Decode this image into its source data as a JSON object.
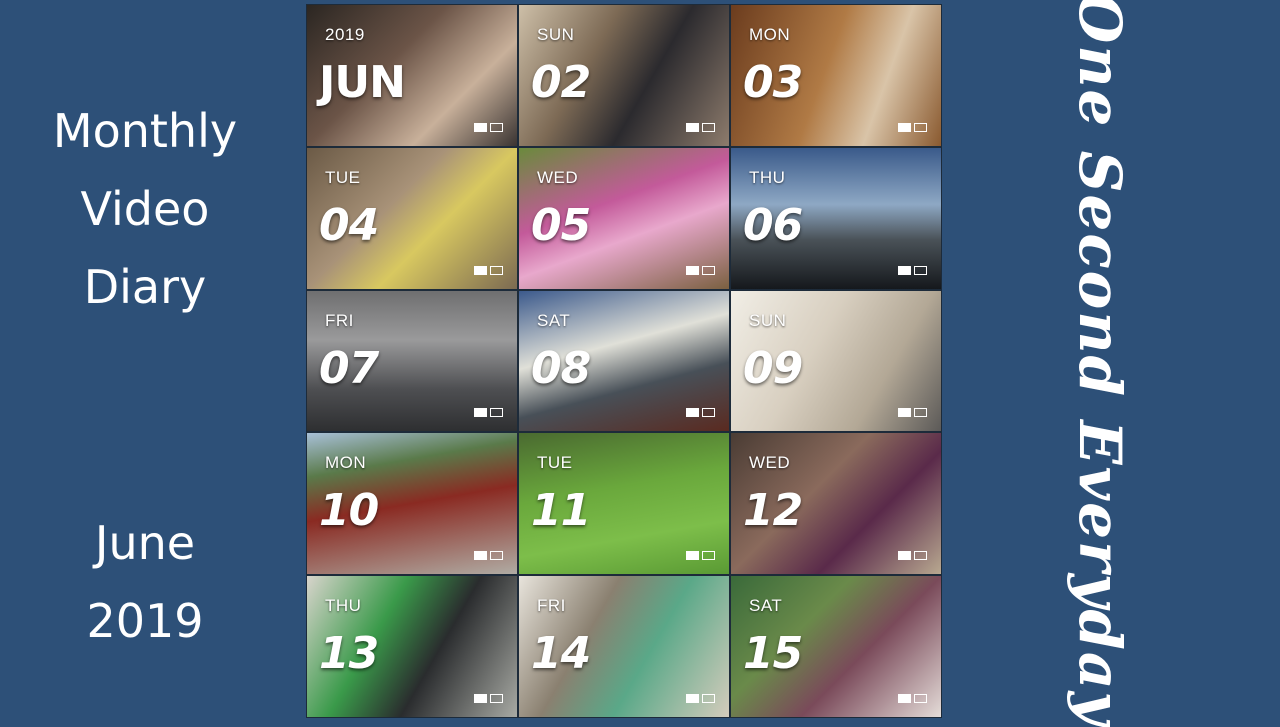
{
  "left_title_lines": [
    "Monthly",
    "Video",
    "Diary"
  ],
  "left_date_lines": [
    "June",
    "2019"
  ],
  "right_script": "One Second Everyday",
  "tiles": [
    {
      "top": "2019",
      "main": "JUN"
    },
    {
      "top": "SUN",
      "main": "02"
    },
    {
      "top": "MON",
      "main": "03"
    },
    {
      "top": "TUE",
      "main": "04"
    },
    {
      "top": "WED",
      "main": "05"
    },
    {
      "top": "THU",
      "main": "06"
    },
    {
      "top": "FRI",
      "main": "07"
    },
    {
      "top": "SAT",
      "main": "08"
    },
    {
      "top": "SUN",
      "main": "09"
    },
    {
      "top": "MON",
      "main": "10"
    },
    {
      "top": "TUE",
      "main": "11"
    },
    {
      "top": "WED",
      "main": "12"
    },
    {
      "top": "THU",
      "main": "13"
    },
    {
      "top": "FRI",
      "main": "14"
    },
    {
      "top": "SAT",
      "main": "15"
    }
  ],
  "colors": {
    "background": "#2d5078",
    "text": "#ffffff"
  },
  "icons": {
    "tile_control": "view-toggle-icon"
  }
}
